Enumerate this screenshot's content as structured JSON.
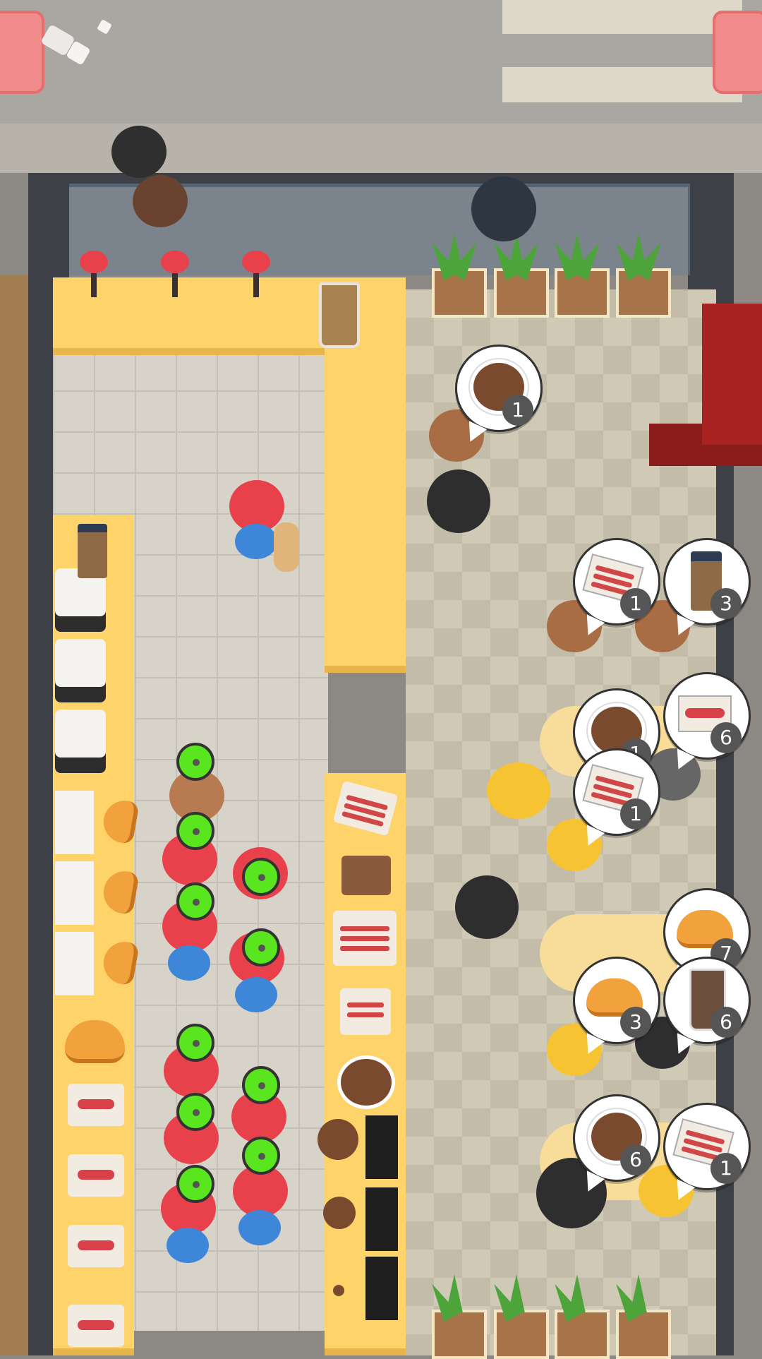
{
  "scene": "coffee shop",
  "orders": [
    {
      "item": "coffee",
      "count": "1"
    },
    {
      "item": "bacon",
      "count": "1"
    },
    {
      "item": "takeaway coffee",
      "count": "3"
    },
    {
      "item": "coffee",
      "count": "1"
    },
    {
      "item": "sausage",
      "count": "6"
    },
    {
      "item": "bacon",
      "count": "1"
    },
    {
      "item": "croissant",
      "count": "7"
    },
    {
      "item": "croissant",
      "count": "3"
    },
    {
      "item": "iced drink",
      "count": "6"
    },
    {
      "item": "coffee",
      "count": "6"
    },
    {
      "item": "bacon",
      "count": "1"
    }
  ],
  "colors": {
    "counter": "#fdd36a",
    "timer_green": "#59e61f",
    "worker_red": "#e8414b",
    "worker_blue": "#3d86d8"
  }
}
